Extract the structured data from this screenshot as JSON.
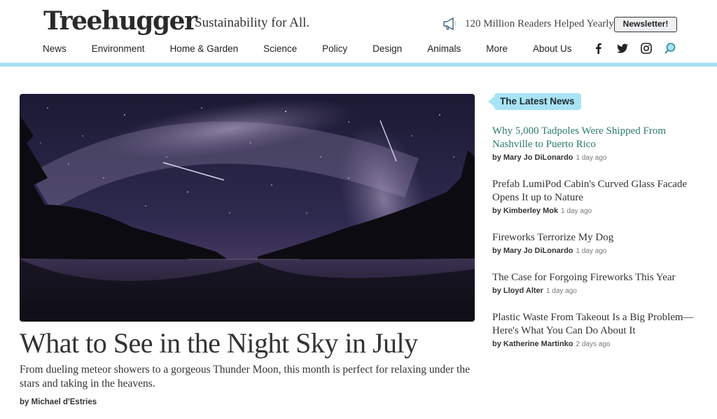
{
  "header": {
    "logo": "Treehugger",
    "tagline": "Sustainability for All.",
    "readers_text": "120 Million Readers Helped Yearly",
    "newsletter_label": "Newsletter!"
  },
  "nav": {
    "items": [
      "News",
      "Environment",
      "Home & Garden",
      "Science",
      "Policy",
      "Design",
      "Animals",
      "More",
      "About Us"
    ]
  },
  "social": {
    "icons": [
      "facebook-icon",
      "twitter-icon",
      "instagram-icon",
      "search-icon"
    ]
  },
  "hero": {
    "title": "What to See in the Night Sky in July",
    "description": "From dueling meteor showers to a gorgeous Thunder Moon, this month is perfect for relaxing under the stars and taking in the heavens.",
    "byline": "by Michael d'Estries"
  },
  "latest": {
    "label": "The Latest News",
    "items": [
      {
        "title": "Why 5,000 Tadpoles Were Shipped From Nashville to Puerto Rico",
        "author": "by Mary Jo DiLonardo",
        "ago": "1 day ago"
      },
      {
        "title": "Prefab LumiPod Cabin's Curved Glass Facade Opens It up to Nature",
        "author": "by Kimberley Mok",
        "ago": "1 day ago"
      },
      {
        "title": "Fireworks Terrorize My Dog",
        "author": "by Mary Jo DiLonardo",
        "ago": "1 day ago"
      },
      {
        "title": "The Case for Forgoing Fireworks This Year",
        "author": "by Lloyd Alter",
        "ago": "1 day ago"
      },
      {
        "title": "Plastic Waste From Takeout Is a Big Problem—Here's What You Can Do About It",
        "author": "by Katherine Martinko",
        "ago": "2 days ago"
      }
    ]
  },
  "colors": {
    "accent": "#a8e3f5",
    "link_teal": "#2c7a6f"
  }
}
